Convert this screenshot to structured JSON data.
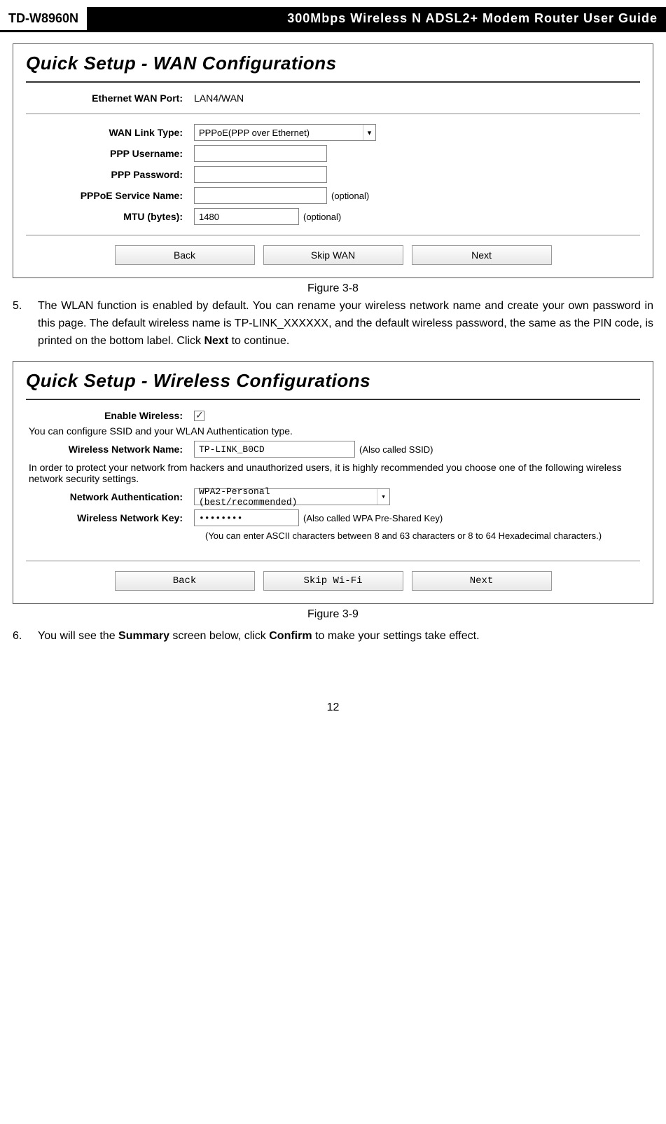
{
  "header": {
    "model": "TD-W8960N",
    "title": "300Mbps Wireless N ADSL2+ Modem Router User Guide"
  },
  "figure1": {
    "title": "Quick Setup - WAN Configurations",
    "ethPortLabel": "Ethernet WAN Port:",
    "ethPortValue": "LAN4/WAN",
    "wanLinkLabel": "WAN Link Type:",
    "wanLinkValue": "PPPoE(PPP over Ethernet)",
    "pppUserLabel": "PPP Username:",
    "pppUserValue": "",
    "pppPassLabel": "PPP Password:",
    "pppPassValue": "",
    "serviceLabel": "PPPoE Service Name:",
    "serviceValue": "",
    "mtuLabel": "MTU (bytes):",
    "mtuValue": "1480",
    "optional": "(optional)",
    "backBtn": "Back",
    "skipBtn": "Skip WAN",
    "nextBtn": "Next",
    "caption": "Figure 3-8"
  },
  "paragraph5": {
    "number": "5.",
    "text_part1": "The WLAN function is enabled by default. You can rename your wireless network name and create your own password in this page. The default wireless name is TP-LINK_XXXXXX, and the default wireless password, the same as the PIN code, is printed on the bottom label. Click ",
    "bold": "Next",
    "text_part2": " to continue."
  },
  "figure2": {
    "title": "Quick Setup - Wireless Configurations",
    "enableLabel": "Enable Wireless:",
    "ssidNote": "You can configure SSID and your WLAN Authentication type.",
    "nameLabel": "Wireless Network Name:",
    "nameValue": "TP-LINK_B0CD",
    "nameHint": "(Also called SSID)",
    "securityNote": "In order to protect your network from hackers and unauthorized users, it is highly recommended you choose one of the following wireless network security settings.",
    "authLabel": "Network Authentication:",
    "authValue": "WPA2-Personal (best/recommended)",
    "keyLabel": "Wireless Network Key:",
    "keyValue": "••••••••",
    "keyHint": "(Also called WPA Pre-Shared Key)",
    "keyNote": "(You can enter ASCII characters between 8 and 63 characters or 8 to 64 Hexadecimal characters.)",
    "backBtn": "Back",
    "skipBtn": "Skip Wi-Fi",
    "nextBtn": "Next",
    "caption": "Figure 3-9"
  },
  "paragraph6": {
    "number": "6.",
    "text_part1": "You will see the ",
    "bold1": "Summary",
    "text_part2": " screen below, click ",
    "bold2": "Confirm",
    "text_part3": " to make your settings take effect."
  },
  "pageNumber": "12"
}
